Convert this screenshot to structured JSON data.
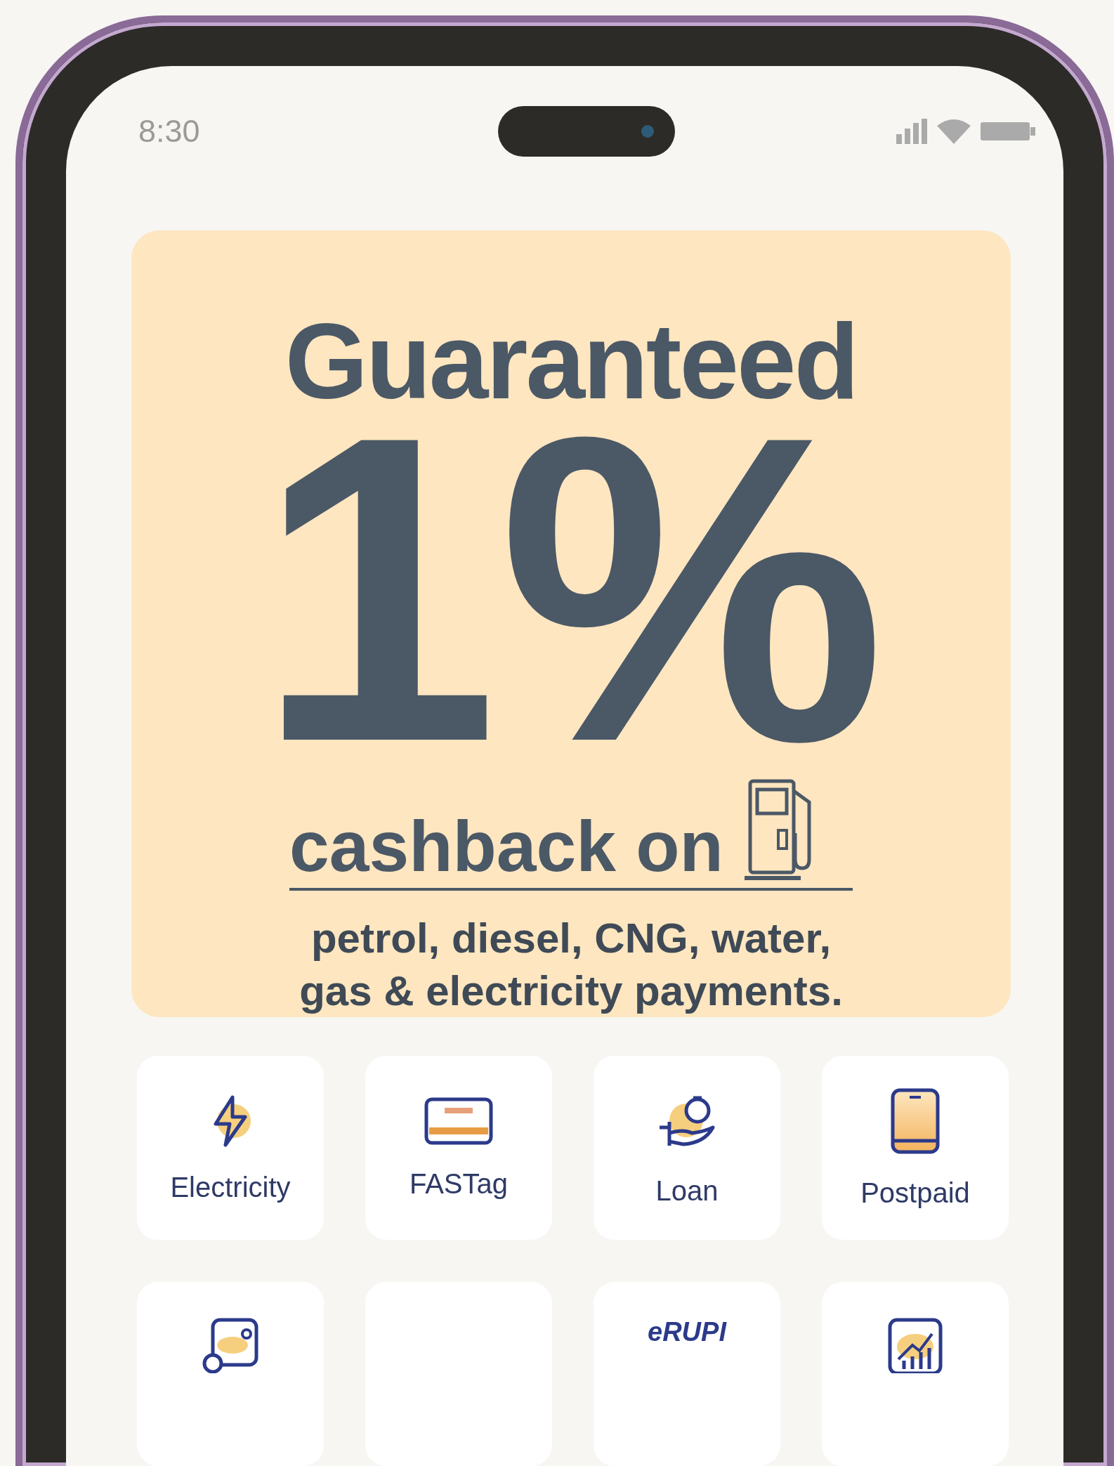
{
  "status_bar": {
    "time": "8:30"
  },
  "banner": {
    "headline": "Guaranteed",
    "figure": "1%",
    "subline": "cashback on",
    "details": "petrol, diesel, CNG, water, gas & electricity payments."
  },
  "services": [
    {
      "kind": "bolt",
      "label": "Electricity"
    },
    {
      "kind": "tag",
      "label": "FASTag"
    },
    {
      "kind": "loan",
      "label": "Loan"
    },
    {
      "kind": "phone",
      "label": "Postpaid"
    },
    {
      "kind": "bill"
    },
    {
      "kind": "blank"
    },
    {
      "kind": "erupi",
      "logo": "eRUPI"
    },
    {
      "kind": "chart"
    }
  ]
}
